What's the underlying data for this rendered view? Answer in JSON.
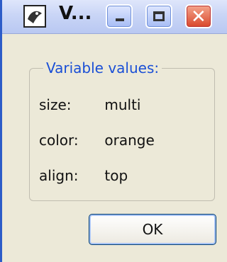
{
  "window": {
    "title": "V..."
  },
  "group": {
    "legend": "Variable values:",
    "rows": [
      {
        "label": "size:",
        "value": "multi"
      },
      {
        "label": "color:",
        "value": "orange"
      },
      {
        "label": "align:",
        "value": "top"
      }
    ]
  },
  "buttons": {
    "ok": "OK"
  },
  "colors": {
    "legend": "#1a4fd6",
    "close": "#d9472b",
    "background": "#ece9d8"
  }
}
